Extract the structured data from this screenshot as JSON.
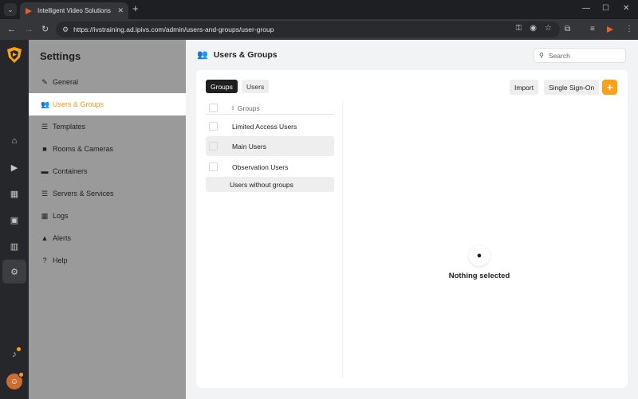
{
  "browser": {
    "tab_title": "Intelligent Video Solutions",
    "url": "https://ivstraining.ad.ipivs.com/admin/users-and-groups/user-group"
  },
  "settings": {
    "title": "Settings",
    "menu": [
      {
        "label": "General",
        "icon": "wrench-icon"
      },
      {
        "label": "Users & Groups",
        "icon": "users-icon"
      },
      {
        "label": "Templates",
        "icon": "list-icon"
      },
      {
        "label": "Rooms & Cameras",
        "icon": "camera-icon"
      },
      {
        "label": "Containers",
        "icon": "container-icon"
      },
      {
        "label": "Servers & Services",
        "icon": "server-icon"
      },
      {
        "label": "Logs",
        "icon": "calendar-icon"
      },
      {
        "label": "Alerts",
        "icon": "warning-icon"
      },
      {
        "label": "Help",
        "icon": "help-icon"
      }
    ],
    "active_item": "Users & Groups"
  },
  "main": {
    "title": "Users & Groups",
    "search_placeholder": "Search",
    "tabs": [
      "Groups",
      "Users"
    ],
    "active_tab": "Groups",
    "buttons": {
      "import": "Import",
      "sso": "Single Sign-On",
      "add": "+"
    },
    "list_header": "Groups",
    "groups": [
      "Limited Access Users",
      "Main Users",
      "Observation Users"
    ],
    "ungrouped_label": "Users without groups",
    "empty_state": "Nothing selected"
  },
  "colors": {
    "accent": "#f7a21b",
    "active_menu_text": "#f29a17",
    "sidebar_bg": "#9a9a9a",
    "rail_bg": "#26272a"
  }
}
